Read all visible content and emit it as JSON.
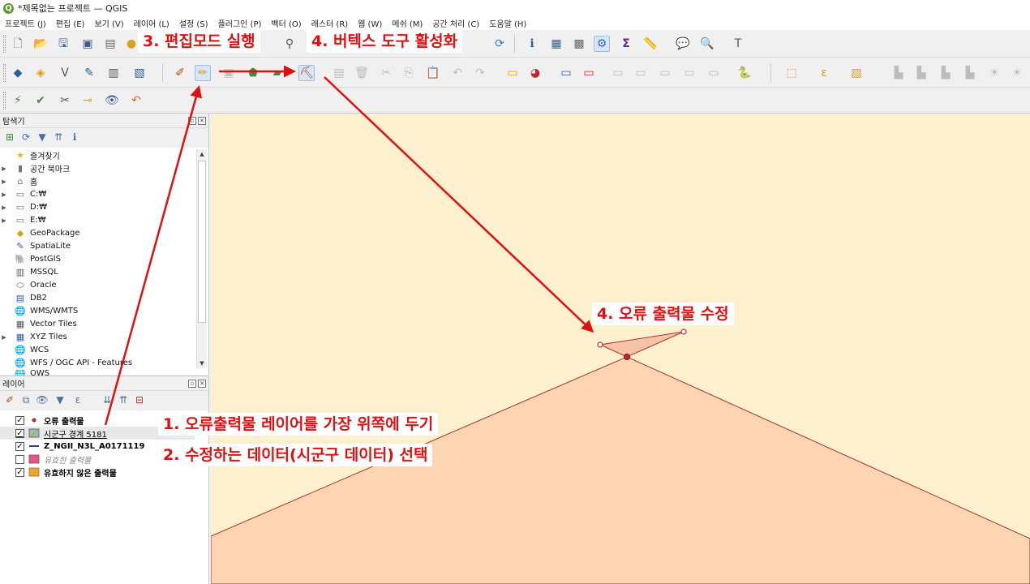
{
  "window": {
    "title": "*제목없는 프로젝트 — QGIS"
  },
  "menu": [
    "프로젝트 (J)",
    "편집 (E)",
    "보기 (V)",
    "레이어 (L)",
    "설정 (S)",
    "플러그인 (P)",
    "벡터 (O)",
    "래스터 (R)",
    "웹 (W)",
    "메쉬 (M)",
    "공간 처리 (C)",
    "도움말 (H)"
  ],
  "browser": {
    "title": "탐색기",
    "items": [
      {
        "label": "즐겨찾기",
        "icon": "star-icon",
        "expandable": false
      },
      {
        "label": "공간 북마크",
        "icon": "bookmark-icon",
        "expandable": true
      },
      {
        "label": "홈",
        "icon": "home-folder-icon",
        "expandable": true
      },
      {
        "label": "C:₩",
        "icon": "folder-icon",
        "expandable": true
      },
      {
        "label": "D:₩",
        "icon": "folder-icon",
        "expandable": true
      },
      {
        "label": "E:₩",
        "icon": "folder-icon",
        "expandable": true
      },
      {
        "label": "GeoPackage",
        "icon": "geopackage-icon",
        "expandable": false
      },
      {
        "label": "SpatiaLite",
        "icon": "spatialite-icon",
        "expandable": false
      },
      {
        "label": "PostGIS",
        "icon": "postgis-icon",
        "expandable": false
      },
      {
        "label": "MSSQL",
        "icon": "mssql-icon",
        "expandable": false
      },
      {
        "label": "Oracle",
        "icon": "oracle-icon",
        "expandable": false
      },
      {
        "label": "DB2",
        "icon": "db2-icon",
        "expandable": false
      },
      {
        "label": "WMS/WMTS",
        "icon": "wms-icon",
        "expandable": false
      },
      {
        "label": "Vector Tiles",
        "icon": "vector-tiles-icon",
        "expandable": false
      },
      {
        "label": "XYZ Tiles",
        "icon": "xyz-tiles-icon",
        "expandable": true
      },
      {
        "label": "WCS",
        "icon": "wcs-icon",
        "expandable": false
      },
      {
        "label": "WFS / OGC API - Features",
        "icon": "wfs-icon",
        "expandable": false
      },
      {
        "label": "OWS",
        "icon": "ows-icon",
        "expandable": false
      }
    ]
  },
  "layers": {
    "title": "레이어",
    "items": [
      {
        "label": "오류 출력물",
        "checked": true,
        "symbol": "point",
        "color": "#c0282d",
        "style": "bold"
      },
      {
        "label": "시군구 경계 5181",
        "checked": true,
        "symbol": "polygon-edit",
        "color": "#8fbfbf",
        "style": "selected"
      },
      {
        "label": "Z_NGII_N3L_A0171119",
        "checked": true,
        "symbol": "line",
        "color": "#2c3e8c",
        "style": "bold"
      },
      {
        "label": "유효한 출력물",
        "checked": false,
        "symbol": "polygon",
        "color": "#e05a8a",
        "style": "italic"
      },
      {
        "label": "유효하지 않은 출력물",
        "checked": true,
        "symbol": "polygon",
        "color": "#e8a830",
        "style": "bold"
      }
    ]
  },
  "annotations": {
    "step3": "3. 편집모드 실행",
    "step4_tool": "4. 버텍스 도구 활성화",
    "step4_fix": "4. 오류 출력물 수정",
    "step1": "1. 오류출력물 레이어를 가장 위쪽에 두기",
    "step2": "2. 수정하는 데이터(시군구 데이터) 선택"
  },
  "colors": {
    "map_background": "#fdf0cf",
    "polygon_fill": "#fdd5b3",
    "polygon_stroke": "#a83228",
    "annotation_red": "#e11010"
  }
}
